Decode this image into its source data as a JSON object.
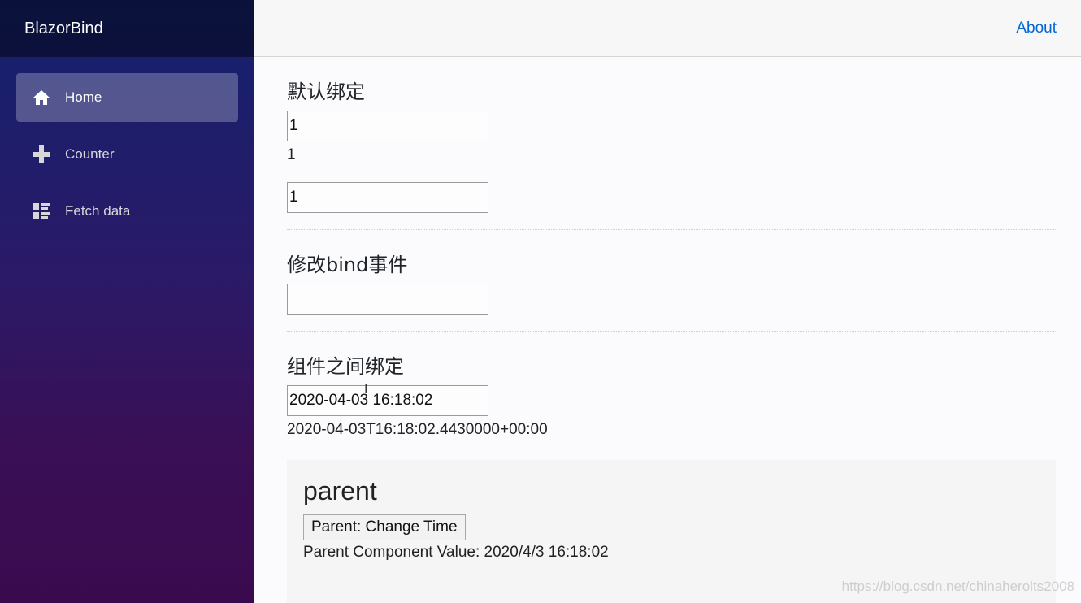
{
  "app": {
    "brand": "BlazorBind"
  },
  "sidebar": {
    "items": [
      {
        "label": "Home",
        "icon": "home-icon",
        "active": true
      },
      {
        "label": "Counter",
        "icon": "plus-icon",
        "active": false
      },
      {
        "label": "Fetch data",
        "icon": "list-rich-icon",
        "active": false
      }
    ]
  },
  "topbar": {
    "about_label": "About"
  },
  "sections": {
    "default_bind": {
      "title": "默认绑定",
      "input1_value": "1",
      "output_text": "1",
      "input2_value": "1"
    },
    "bind_event": {
      "title": "修改bind事件",
      "input_value": ""
    },
    "component_bind": {
      "title": "组件之间绑定",
      "input_value": "2020-04-03 16:18:02",
      "output_text": "2020-04-03T16:18:02.4430000+00:00"
    }
  },
  "parent": {
    "title": "parent",
    "button_label": "Parent: Change Time",
    "value_text": "Parent Component Value: 2020/4/3 16:18:02"
  },
  "watermark": "https://blog.csdn.net/chinaherolts2008",
  "colors": {
    "link": "#0366d6",
    "sidebar_top": "#13216d",
    "sidebar_bottom": "#3a0a4e"
  }
}
